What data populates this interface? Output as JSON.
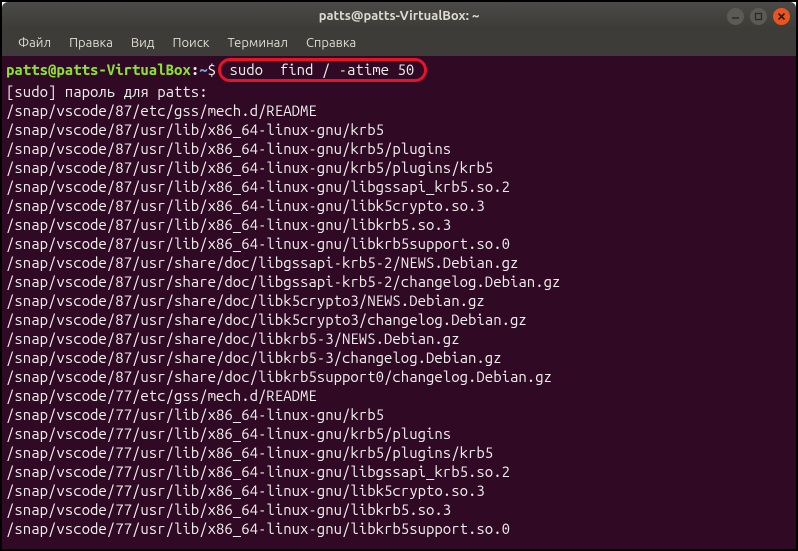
{
  "window": {
    "title": "patts@patts-VirtualBox: ~"
  },
  "menubar": {
    "file": "Файл",
    "edit": "Правка",
    "view": "Вид",
    "search": "Поиск",
    "terminal": "Терминал",
    "help": "Справка"
  },
  "prompt": {
    "userhost": "patts@patts-VirtualBox",
    "colon": ":",
    "path": "~",
    "symbol": "$"
  },
  "command": "sudo  find / -atime 50",
  "sudo_prompt": "[sudo] пароль для patts:",
  "output_lines": [
    "/snap/vscode/87/etc/gss/mech.d/README",
    "/snap/vscode/87/usr/lib/x86_64-linux-gnu/krb5",
    "/snap/vscode/87/usr/lib/x86_64-linux-gnu/krb5/plugins",
    "/snap/vscode/87/usr/lib/x86_64-linux-gnu/krb5/plugins/krb5",
    "/snap/vscode/87/usr/lib/x86_64-linux-gnu/libgssapi_krb5.so.2",
    "/snap/vscode/87/usr/lib/x86_64-linux-gnu/libk5crypto.so.3",
    "/snap/vscode/87/usr/lib/x86_64-linux-gnu/libkrb5.so.3",
    "/snap/vscode/87/usr/lib/x86_64-linux-gnu/libkrb5support.so.0",
    "/snap/vscode/87/usr/share/doc/libgssapi-krb5-2/NEWS.Debian.gz",
    "/snap/vscode/87/usr/share/doc/libgssapi-krb5-2/changelog.Debian.gz",
    "/snap/vscode/87/usr/share/doc/libk5crypto3/NEWS.Debian.gz",
    "/snap/vscode/87/usr/share/doc/libk5crypto3/changelog.Debian.gz",
    "/snap/vscode/87/usr/share/doc/libkrb5-3/NEWS.Debian.gz",
    "/snap/vscode/87/usr/share/doc/libkrb5-3/changelog.Debian.gz",
    "/snap/vscode/87/usr/share/doc/libkrb5support0/changelog.Debian.gz",
    "/snap/vscode/77/etc/gss/mech.d/README",
    "/snap/vscode/77/usr/lib/x86_64-linux-gnu/krb5",
    "/snap/vscode/77/usr/lib/x86_64-linux-gnu/krb5/plugins",
    "/snap/vscode/77/usr/lib/x86_64-linux-gnu/krb5/plugins/krb5",
    "/snap/vscode/77/usr/lib/x86_64-linux-gnu/libgssapi_krb5.so.2",
    "/snap/vscode/77/usr/lib/x86_64-linux-gnu/libk5crypto.so.3",
    "/snap/vscode/77/usr/lib/x86_64-linux-gnu/libkrb5.so.3",
    "/snap/vscode/77/usr/lib/x86_64-linux-gnu/libkrb5support.so.0"
  ]
}
